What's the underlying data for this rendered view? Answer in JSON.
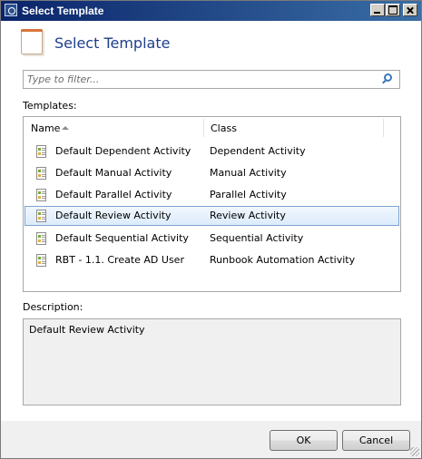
{
  "window": {
    "title": "Select Template"
  },
  "header": {
    "title": "Select Template"
  },
  "filter": {
    "placeholder": "Type to filter...",
    "value": ""
  },
  "templates": {
    "label": "Templates:",
    "columns": {
      "name": "Name",
      "class": "Class"
    },
    "rows": [
      {
        "name": "Default Dependent Activity",
        "class": "Dependent Activity"
      },
      {
        "name": "Default Manual Activity",
        "class": "Manual Activity"
      },
      {
        "name": "Default Parallel Activity",
        "class": "Parallel Activity"
      },
      {
        "name": "Default Review Activity",
        "class": "Review Activity",
        "selected": true
      },
      {
        "name": "Default Sequential Activity",
        "class": "Sequential Activity"
      },
      {
        "name": "RBT - 1.1. Create AD User",
        "class": "Runbook Automation Activity"
      }
    ]
  },
  "description": {
    "label": "Description:",
    "text": "Default Review Activity"
  },
  "buttons": {
    "ok": "OK",
    "cancel": "Cancel"
  },
  "icons": {
    "header": "template-icon",
    "search": "search-icon",
    "row": "template-item-icon"
  }
}
